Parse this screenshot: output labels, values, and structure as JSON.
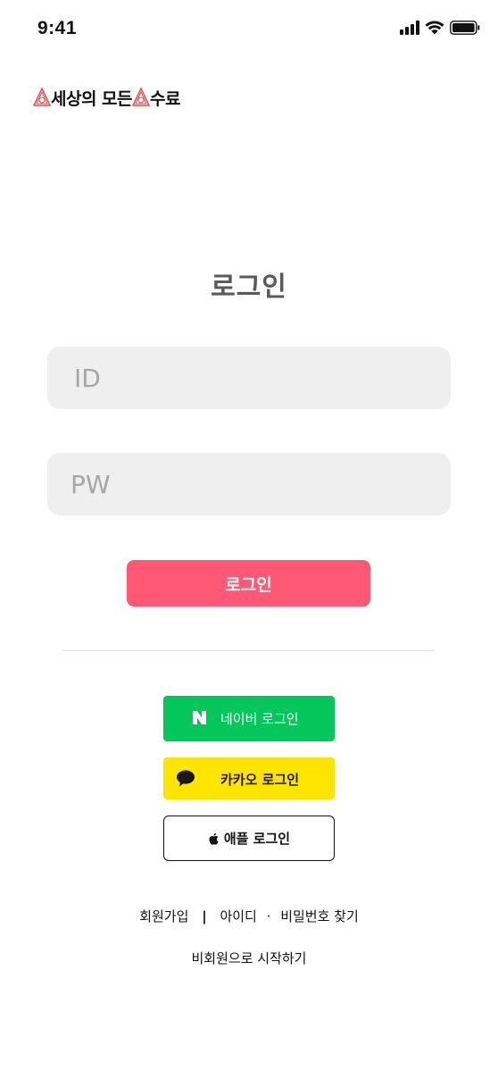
{
  "status_bar": {
    "time": "9:41"
  },
  "logo": {
    "text_part1": "세상의 모든 ",
    "text_part2": "수료"
  },
  "page": {
    "title": "로그인"
  },
  "form": {
    "id_placeholder": "ID",
    "pw_placeholder": "PW",
    "login_label": "로그인"
  },
  "social": {
    "naver_label": "네이버 로그인",
    "kakao_label": "카카오 로그인",
    "apple_label": "애플 로그인"
  },
  "footer": {
    "signup_label": "회원가입",
    "link_separator": "|",
    "find_id_label": "아이디",
    "dot_separator": "·",
    "find_pw_label": "비밀번호 찾기",
    "guest_label": "비회원으로 시작하기"
  },
  "colors": {
    "accent": "#ff5875",
    "naver": "#03c75a",
    "kakao": "#fee500",
    "field_bg": "#efefef",
    "logo_mark": "#d9534f"
  }
}
